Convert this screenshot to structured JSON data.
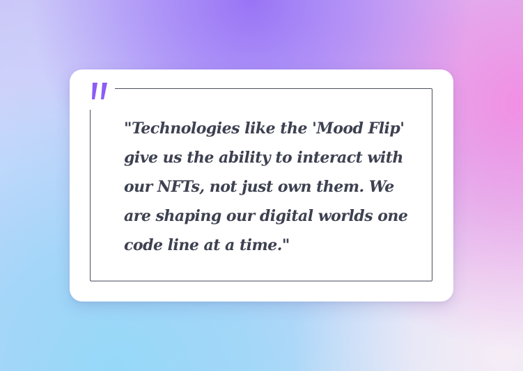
{
  "background": {
    "colors": [
      "#9670f6",
      "#f58be2",
      "#96d8f8",
      "#f6ecf6"
    ]
  },
  "card": {
    "quote_icon": "quote-mark-icon",
    "quote_icon_color": "#8b5cf6",
    "quote_text": "\"Technologies like the 'Mood Flip' give us the ability to interact with our NFTs, not just own them. We are shaping our digital worlds one code line at a time.\""
  }
}
